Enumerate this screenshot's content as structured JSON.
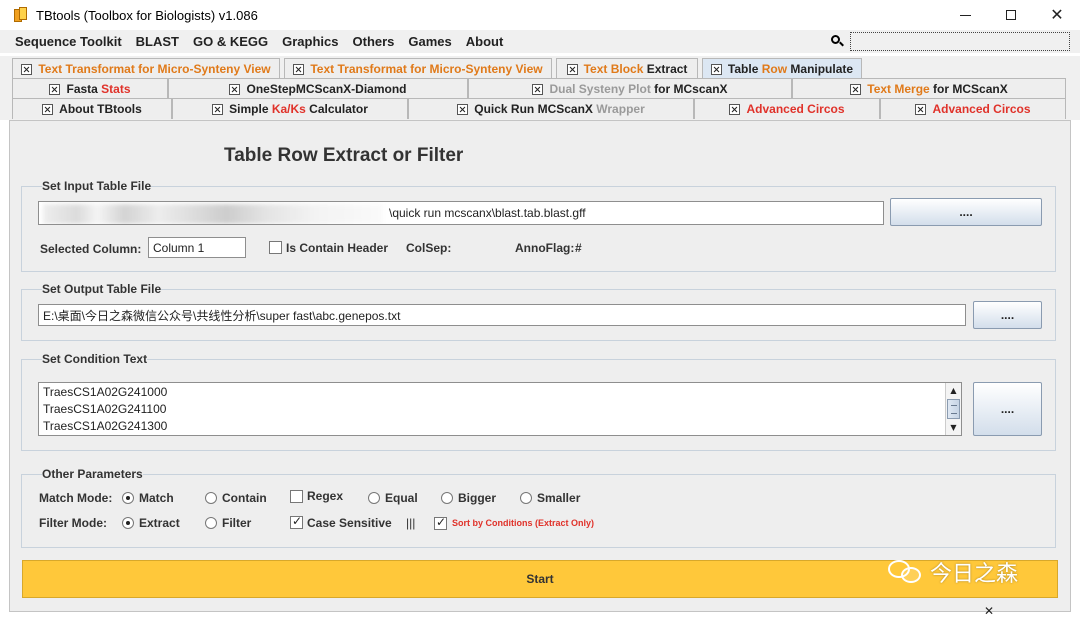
{
  "window": {
    "title": "TBtools (Toolbox for Biologists) v1.086"
  },
  "menu": [
    "Sequence Toolkit",
    "BLAST",
    "GO & KEGG",
    "Graphics",
    "Others",
    "Games",
    "About"
  ],
  "tabs": {
    "row1": [
      {
        "parts": [
          {
            "t": "Text Transformat for Micro-Synteny View",
            "c": "orange"
          }
        ]
      },
      {
        "parts": [
          {
            "t": "Text Transformat for Micro-Synteny View",
            "c": "orange"
          }
        ]
      },
      {
        "parts": [
          {
            "t": "Text Block ",
            "c": "orange"
          },
          {
            "t": "Extract",
            "c": "black"
          }
        ]
      },
      {
        "parts": [
          {
            "t": "Table ",
            "c": "black"
          },
          {
            "t": "Row",
            "c": "orange"
          },
          {
            "t": " Manipulate",
            "c": "black"
          }
        ]
      }
    ],
    "row2": [
      {
        "parts": [
          {
            "t": "Fasta ",
            "c": "black"
          },
          {
            "t": "Stats",
            "c": "red"
          }
        ]
      },
      {
        "parts": [
          {
            "t": "OneStepMCScanX-Diamond",
            "c": "black"
          }
        ]
      },
      {
        "parts": [
          {
            "t": "Dual Systeny Plot",
            "c": "grey"
          },
          {
            "t": " for MCscanX",
            "c": "black"
          }
        ]
      },
      {
        "parts": [
          {
            "t": "Text Merge",
            "c": "orange"
          },
          {
            "t": " for MCScanX",
            "c": "black"
          }
        ]
      }
    ],
    "row3": [
      {
        "parts": [
          {
            "t": "About TBtools",
            "c": "black"
          }
        ]
      },
      {
        "parts": [
          {
            "t": "Simple ",
            "c": "black"
          },
          {
            "t": "Ka/Ks",
            "c": "red"
          },
          {
            "t": " Calculator",
            "c": "black"
          }
        ]
      },
      {
        "parts": [
          {
            "t": "Quick Run MCScanX ",
            "c": "black"
          },
          {
            "t": "Wrapper",
            "c": "grey"
          }
        ]
      },
      {
        "parts": [
          {
            "t": "Advanced Circos",
            "c": "red"
          }
        ]
      },
      {
        "parts": [
          {
            "t": "Advanced Circos",
            "c": "red"
          }
        ]
      }
    ]
  },
  "page": {
    "title": "Table Row Extract or Filter",
    "input": {
      "group_title": "Set Input Table File",
      "path_visible": "\\quick run mcscanx\\blast.tab.blast.gff",
      "browse_label": "....",
      "selected_column_label": "Selected Column:",
      "selected_column_value": "Column 1",
      "contain_header_label": "Is Contain Header",
      "contain_header_checked": false,
      "colsep_label": "ColSep:",
      "annoflag_label": "AnnoFlag:",
      "annoflag_value": "#"
    },
    "output": {
      "group_title": "Set Output Table File",
      "path": "E:\\桌面\\今日之森微信公众号\\共线性分析\\super fast\\abc.genepos.txt",
      "browse_label": "...."
    },
    "condition": {
      "group_title": "Set Condition Text",
      "lines": [
        "TraesCS1A02G241000",
        "TraesCS1A02G241100",
        "TraesCS1A02G241300"
      ],
      "browse_label": "...."
    },
    "params": {
      "group_title": "Other Parameters",
      "match_mode_label": "Match Mode:",
      "match_options": [
        "Match",
        "Contain"
      ],
      "match_selected": "Match",
      "regex_label": "Regex",
      "regex_checked": false,
      "match_options2": [
        "Equal",
        "Bigger",
        "Smaller"
      ],
      "filter_mode_label": "Filter Mode:",
      "filter_options": [
        "Extract",
        "Filter"
      ],
      "filter_selected": "Extract",
      "case_sensitive_label": "Case Sensitive",
      "case_sensitive_checked": true,
      "separator": "|||",
      "sort_label": "Sort by Conditions (Extract Only)",
      "sort_checked": true,
      "sort_color": "#e0322a"
    },
    "start_label": "Start",
    "start_color": "#ffc83a"
  },
  "watermark": "今日之森"
}
